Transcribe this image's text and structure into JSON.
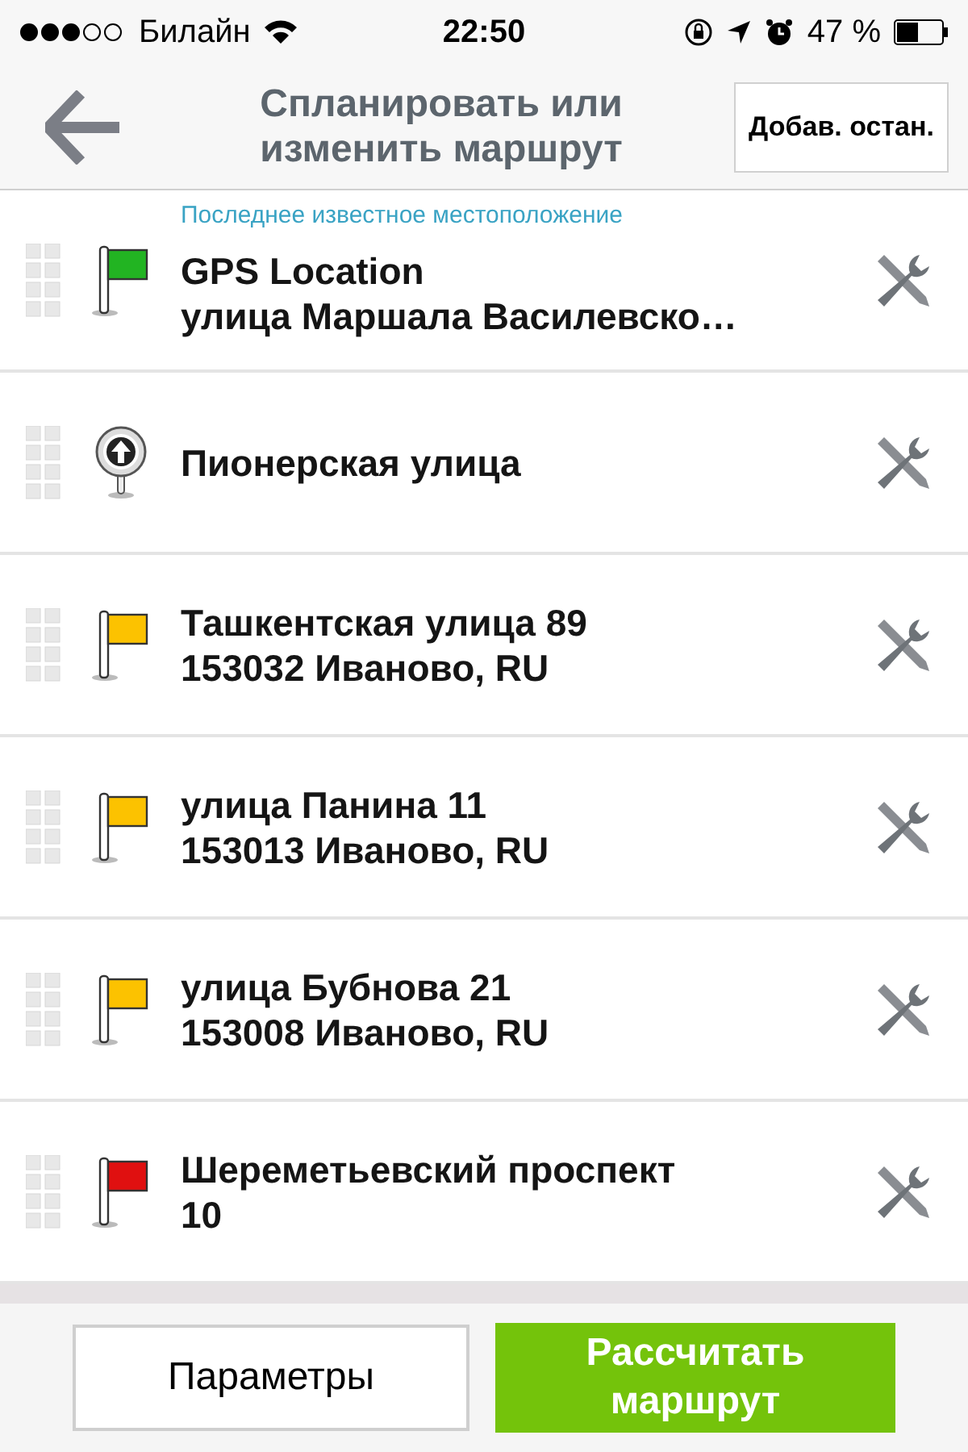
{
  "status_bar": {
    "carrier": "Билайн",
    "time": "22:50",
    "battery": "47 %"
  },
  "header": {
    "title": "Спланировать или изменить маршрут",
    "add_stop_button": "Добав. остан."
  },
  "stops": [
    {
      "kind": "flag",
      "color": "#22b422",
      "caption": "Последнее известное местоположение",
      "lines": [
        "GPS Location",
        "улица Маршала Василевско…"
      ]
    },
    {
      "kind": "waypoint",
      "lines": [
        "Пионерская улица"
      ]
    },
    {
      "kind": "flag",
      "color": "#fcc200",
      "lines": [
        "Ташкентская улица 89",
        "153032 Иваново, RU"
      ]
    },
    {
      "kind": "flag",
      "color": "#fcc200",
      "lines": [
        "улица Панина 11",
        "153013 Иваново, RU"
      ]
    },
    {
      "kind": "flag",
      "color": "#fcc200",
      "lines": [
        "улица Бубнова 21",
        "153008 Иваново, RU"
      ]
    },
    {
      "kind": "flag",
      "color": "#e01010",
      "lines": [
        "Шереметьевский проспект",
        "10"
      ]
    }
  ],
  "footer": {
    "options_button": "Параметры",
    "calculate_button": "Рассчитать маршрут"
  }
}
